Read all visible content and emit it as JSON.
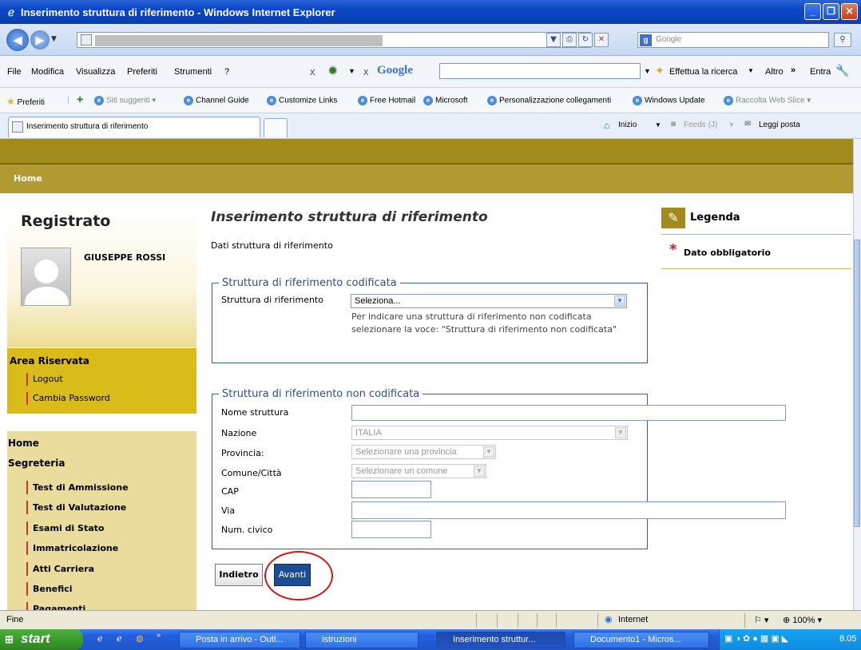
{
  "window": {
    "title": "Inserimento struttura di riferimento - Windows Internet Explorer"
  },
  "browser": {
    "google_search_placeholder": "Google",
    "menu": [
      "File",
      "Modifica",
      "Visualizza",
      "Preferiti",
      "Strumenti",
      "?"
    ],
    "google_toolbar": {
      "label": "Google",
      "search_button": "Effettua la ricerca",
      "altro": "Altro",
      "entra": "Entra"
    },
    "favorites": {
      "preferiti": "Preferiti",
      "items": [
        "Siti suggeriti",
        "Channel Guide",
        "Customize Links",
        "Free Hotmail",
        "Microsoft",
        "Personalizzazione collegamenti",
        "Windows Update",
        "Raccolta Web Slice"
      ]
    },
    "tab_title": "Inserimento struttura di riferimento",
    "command_bar": {
      "home": "Inizio",
      "feeds": "Feeds (J)",
      "read_mail": "Leggi posta"
    }
  },
  "page": {
    "breadcrumb": "Home",
    "sidebar": {
      "registered_title": "Registrato",
      "user_name": "GIUSEPPE ROSSI",
      "reserved_area_title": "Area Riservata",
      "reserved_links": [
        "Logout",
        "Cambia Password"
      ],
      "home": "Home",
      "segreteria": "Segreteria",
      "segreteria_links": [
        "Test di Ammissione",
        "Test di Valutazione",
        "Esami di Stato",
        "Immatricolazione",
        "Atti Carriera",
        "Benefici",
        "Pagamenti"
      ]
    },
    "title": "Inserimento struttura di riferimento",
    "subtitle": "Dati struttura di riferimento",
    "coded_section": {
      "legend": "Struttura di riferimento codificata",
      "field_label": "Struttura di riferimento",
      "select_value": "Seleziona...",
      "hint": "Per indicare una struttura di riferimento non codificata selezionare la voce: \"Struttura di riferimento non codificata\""
    },
    "uncoded_section": {
      "legend": "Struttura di riferimento non codificata",
      "labels": {
        "name": "Nome struttura",
        "nation": "Nazione",
        "province": "Provincia:",
        "city": "Comune/Città",
        "cap": "CAP",
        "street": "Via",
        "civic": "Num. civico"
      },
      "nation_value": "ITALIA",
      "province_value": "Selezionare una provincia",
      "city_value": "Selezionare un comune"
    },
    "buttons": {
      "back": "Indietro",
      "next": "Avanti"
    },
    "legend_box": {
      "title": "Legenda",
      "required": "Dato obbligatorio"
    }
  },
  "statusbar": {
    "text": "Fine",
    "zone": "Internet",
    "zoom": "100%"
  },
  "taskbar": {
    "start": "start",
    "tasks": [
      "Posta in arrivo - Outl...",
      "istruzioni",
      "Inserimento struttur...",
      "Documento1 - Micros..."
    ],
    "clock": "8.05"
  },
  "colors": {
    "header_gold": "#a38a1c",
    "sidebar_gold": "#d9bb1a",
    "fieldset_blue": "#3f5f8c",
    "primary_button": "#1c4d93",
    "required_star": "#c81d1d",
    "annotation_circle": "#d21616"
  }
}
